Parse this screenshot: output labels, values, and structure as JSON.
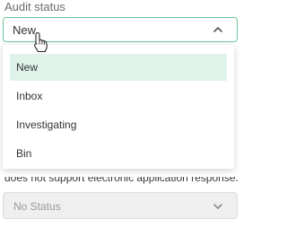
{
  "audit_status": {
    "label": "Audit status",
    "value": "New",
    "options": [
      "New",
      "Inbox",
      "Investigating",
      "Bin"
    ],
    "selected_index": 0
  },
  "background": {
    "partial_text": "does not support electronic application response.",
    "select_value": "No Status"
  },
  "colors": {
    "focus_border": "#6cc79a",
    "selected_bg": "#dff3ea"
  },
  "icons": {
    "open_indicator": "chevron-up-icon",
    "closed_indicator": "chevron-down-icon",
    "cursor": "hand-pointer-icon"
  }
}
